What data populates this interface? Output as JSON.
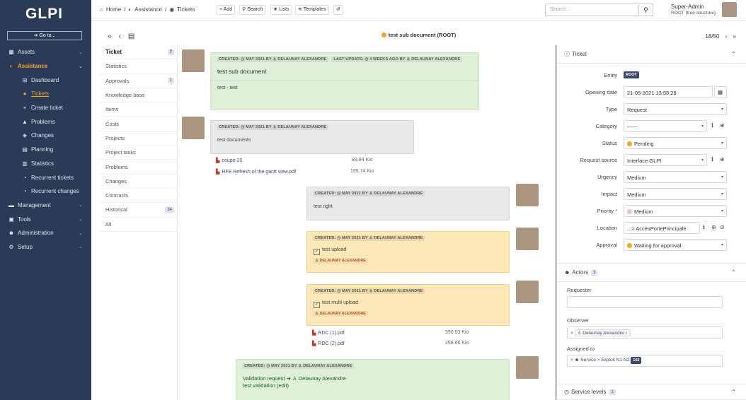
{
  "sidebar": {
    "logo": "GLPI",
    "goto": "Go to...",
    "items": [
      {
        "label": "Assets",
        "icon": "box-icon"
      },
      {
        "label": "Assistance",
        "icon": "headset-icon"
      },
      {
        "label": "Dashboard",
        "icon": "dashboard-icon"
      },
      {
        "label": "Tickets",
        "icon": "ticket-icon"
      },
      {
        "label": "Create ticket",
        "icon": "plus-icon"
      },
      {
        "label": "Problems",
        "icon": "warning-icon"
      },
      {
        "label": "Changes",
        "icon": "changes-icon"
      },
      {
        "label": "Planning",
        "icon": "calendar-icon"
      },
      {
        "label": "Statistics",
        "icon": "chart-icon"
      },
      {
        "label": "Recurrent tickets",
        "icon": "recurrent-icon"
      },
      {
        "label": "Recurrent changes",
        "icon": "recurrent-icon"
      },
      {
        "label": "Management",
        "icon": "wallet-icon"
      },
      {
        "label": "Tools",
        "icon": "briefcase-icon"
      },
      {
        "label": "Administration",
        "icon": "users-icon"
      },
      {
        "label": "Setup",
        "icon": "cogs-icon"
      }
    ]
  },
  "topbar": {
    "crumbs": [
      "Home",
      "Assistance",
      "Tickets"
    ],
    "buttons": [
      "Add",
      "Search",
      "Lists",
      "Templates"
    ],
    "search_placeholder": "Search...",
    "user_name": "Super-Admin",
    "user_entity": "ROOT (tree structure)"
  },
  "ticket": {
    "title": "test sub document (ROOT)",
    "pager": "18/50"
  },
  "tabs": [
    {
      "label": "Ticket",
      "count": "7"
    },
    {
      "label": "Statistics",
      "count": ""
    },
    {
      "label": "Approvals",
      "count": "1"
    },
    {
      "label": "Knowledge base",
      "count": ""
    },
    {
      "label": "Items",
      "count": ""
    },
    {
      "label": "Costs",
      "count": ""
    },
    {
      "label": "Projects",
      "count": ""
    },
    {
      "label": "Project tasks",
      "count": ""
    },
    {
      "label": "Problems",
      "count": ""
    },
    {
      "label": "Changes",
      "count": ""
    },
    {
      "label": "Contracts",
      "count": ""
    },
    {
      "label": "Historical",
      "count": "34"
    },
    {
      "label": "All",
      "count": ""
    }
  ],
  "timeline": {
    "m1": {
      "created": "CREATED: ◷ MAY 2021 BY ♙ DELAUNAY ALEXANDRE",
      "updated": "LAST UPDATE: ◷ 4 WEEKS AGO BY ♙ DELAUNAY ALEXANDRE",
      "title": "test sub document",
      "body": "test - test"
    },
    "m2": {
      "created": "CREATED: ◷ MAY 2021 BY ♙ DELAUNAY ALEXANDRE",
      "body": "test documents"
    },
    "docs1": [
      {
        "name": "coupe-20",
        "size": "89.94 Kio"
      },
      {
        "name": "RFE Refresh of the gantt view.pdf",
        "size": "195.74 Kio"
      }
    ],
    "m3": {
      "created": "CREATED: ◷ MAY 2021 BY ♙ DELAUNAY ALEXANDRE",
      "body": "test right"
    },
    "m4": {
      "created": "CREATED: ◷ MAY 2021 BY ♙ DELAUNAY ALEXANDRE",
      "body": "test upload",
      "assignee": "DELAUNAY ALEXANDRE"
    },
    "m5": {
      "created": "CREATED: ◷ MAY 2021 BY ♙ DELAUNAY ALEXANDRE",
      "body": "test multi upload",
      "assignee": "DELAUNAY ALEXANDRE"
    },
    "docs2": [
      {
        "name": "RDC (1).pdf",
        "size": "390.53 Kio"
      },
      {
        "name": "RDC (2).pdf",
        "size": "268.66 Kio"
      }
    ],
    "m6": {
      "created": "CREATED: ◷ MAY 2021 BY ♙ DELAUNAY ALEXANDRE",
      "line1": "Validation request ➔ ♙ Delaunay Alexandre",
      "line2": "test validation (edit)"
    }
  },
  "panel": {
    "ticket_title": "Ticket",
    "fields": {
      "entity": {
        "label": "Entity",
        "value": "ROOT"
      },
      "opening": {
        "label": "Opening date",
        "value": "21-05-2021 13:58:28"
      },
      "type": {
        "label": "Type",
        "value": "Request"
      },
      "category": {
        "label": "Category",
        "value": "------"
      },
      "status": {
        "label": "Status",
        "value": "Pending"
      },
      "source": {
        "label": "Request source",
        "value": "Interface GLPI"
      },
      "urgency": {
        "label": "Urgency",
        "value": "Medium"
      },
      "impact": {
        "label": "Impact",
        "value": "Medium"
      },
      "priority": {
        "label": "Priority",
        "value": "Medium"
      },
      "location": {
        "label": "Location",
        "value": "...> AccèsPortePrincipale"
      },
      "approval": {
        "label": "Approval",
        "value": "Waiting for approval"
      }
    },
    "actors_title": "Actors",
    "actors_count": "3",
    "requester_label": "Requester",
    "observer_label": "Observer",
    "observer_value": "Delaunay Alexandre",
    "assigned_label": "Assigned to",
    "assigned_value": "Service > Exploit N1-N2",
    "assigned_count": "102",
    "service_title": "Service levels",
    "service_count": "1"
  },
  "colors": {
    "sidebar": "#2b3a57",
    "accent": "#f5a623",
    "green": "#dff0d8",
    "orange": "#fde8b8"
  }
}
